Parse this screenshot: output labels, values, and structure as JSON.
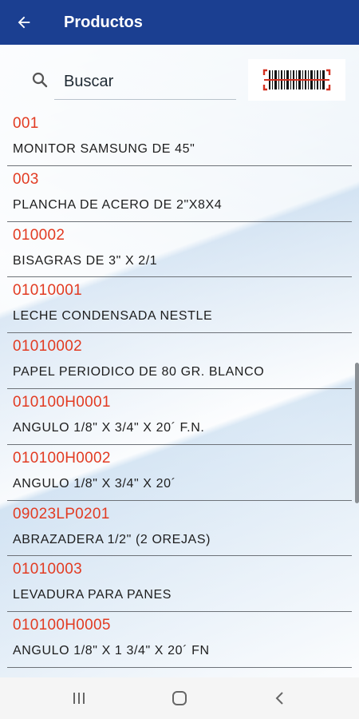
{
  "app_bar": {
    "title": "Productos",
    "back_icon": "arrow-left-icon",
    "background": "#1b3f91"
  },
  "search": {
    "placeholder": "Buscar",
    "icon": "search-icon"
  },
  "scan_button": {
    "icon": "barcode-scanner-icon"
  },
  "products": [
    {
      "code": "001",
      "name": "MONITOR SAMSUNG DE 45\""
    },
    {
      "code": "003",
      "name": "PLANCHA DE ACERO DE 2\"X8X4"
    },
    {
      "code": "010002",
      "name": "BISAGRAS DE 3\" X 2/1"
    },
    {
      "code": "01010001",
      "name": "LECHE CONDENSADA NESTLE"
    },
    {
      "code": "01010002",
      "name": "PAPEL PERIODICO DE 80 GR. BLANCO"
    },
    {
      "code": "010100H0001",
      "name": "ANGULO 1/8\" X 3/4\" X 20´ F.N."
    },
    {
      "code": "010100H0002",
      "name": "ANGULO 1/8\" X 3/4\" X 20´"
    },
    {
      "code": "09023LP0201",
      "name": "ABRAZADERA 1/2\" (2 OREJAS)"
    },
    {
      "code": "01010003",
      "name": "LEVADURA PARA PANES"
    },
    {
      "code": "010100H0005",
      "name": "ANGULO 1/8\" X 1 3/4\" X 20´  FN"
    }
  ],
  "colors": {
    "code_text": "#e23b22",
    "accent": "#1b3f91"
  },
  "nav_bar": {
    "recents_icon": "recents-icon",
    "home_icon": "home-icon",
    "back_icon": "back-chevron-icon"
  }
}
